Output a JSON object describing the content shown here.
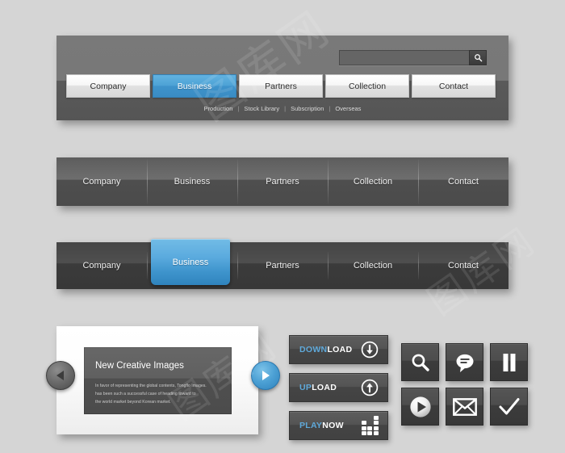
{
  "page": {
    "background_color": "#d5d5d5",
    "accent_blue": "#4ca0d4",
    "dark_gray": "#4c4c4c",
    "watermark_text": "图库网"
  },
  "header": {
    "search": {
      "value": "",
      "placeholder": "",
      "button_icon": "search-icon"
    },
    "tabs": [
      {
        "label": "Company",
        "active": false
      },
      {
        "label": "Business",
        "active": true
      },
      {
        "label": "Partners",
        "active": false
      },
      {
        "label": "Collection",
        "active": false
      },
      {
        "label": "Contact",
        "active": false
      }
    ],
    "subnav": [
      {
        "label": "Production"
      },
      {
        "label": "Stock Library"
      },
      {
        "label": "Subscription"
      },
      {
        "label": "Overseas"
      }
    ],
    "subnav_separator": "|"
  },
  "bar_plain": {
    "items": [
      {
        "label": "Company"
      },
      {
        "label": "Business"
      },
      {
        "label": "Partners"
      },
      {
        "label": "Collection"
      },
      {
        "label": "Contact"
      }
    ]
  },
  "bar_raised": {
    "items": [
      {
        "label": "Company"
      },
      {
        "label": "Business"
      },
      {
        "label": "Partners"
      },
      {
        "label": "Collection"
      },
      {
        "label": "Contact"
      }
    ],
    "active_label": "Business",
    "active_index": 1
  },
  "carousel": {
    "slide_title": "New Creative Images",
    "slide_body_lines": [
      "In favor of representing the global contents, Tongflo Images.",
      "has been such a successful case of heading toward to",
      "the world market beyond Korean market."
    ],
    "prev_icon": "chevron-left-icon",
    "next_icon": "chevron-right-icon"
  },
  "action_buttons": [
    {
      "label_blue": "DOWN",
      "label_white": "LOAD",
      "icon": "arrow-down-circle-icon"
    },
    {
      "label_blue": "UP",
      "label_white": "LOAD",
      "icon": "arrow-up-circle-icon"
    },
    {
      "label_blue": "PLAY",
      "label_white": "NOW",
      "icon": "equalizer-icon"
    }
  ],
  "icon_tiles": [
    {
      "name": "search-icon"
    },
    {
      "name": "speech-bubble-icon"
    },
    {
      "name": "pause-icon"
    },
    {
      "name": "play-icon"
    },
    {
      "name": "envelope-icon"
    },
    {
      "name": "check-icon"
    }
  ]
}
